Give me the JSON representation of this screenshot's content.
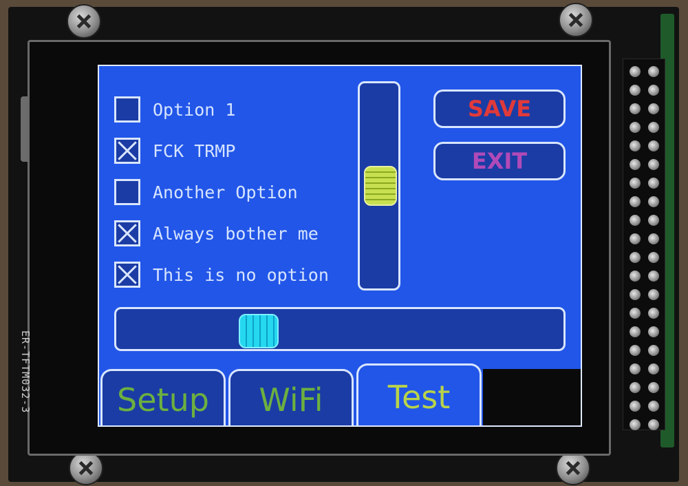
{
  "device": {
    "vertical_label": "ER-TFTM032-3"
  },
  "options": [
    {
      "label": "Option 1",
      "checked": false
    },
    {
      "label": "FCK TRMP",
      "checked": true
    },
    {
      "label": "Another Option",
      "checked": false
    },
    {
      "label": "Always bother me",
      "checked": true
    },
    {
      "label": "This is no option",
      "checked": true
    }
  ],
  "buttons": {
    "save": {
      "label": "SAVE",
      "color": "#e03a3a"
    },
    "exit": {
      "label": "EXIT",
      "color": "#b04ab8"
    }
  },
  "sliders": {
    "vertical": {
      "value_fraction": 0.5
    },
    "horizontal": {
      "value_fraction": 0.3
    }
  },
  "tabs": [
    {
      "label": "Setup",
      "active": false
    },
    {
      "label": "WiFi",
      "active": false
    },
    {
      "label": "Test",
      "active": true
    }
  ],
  "colors": {
    "screen_bg": "#2256e8",
    "accent": "#d9e6ff"
  }
}
